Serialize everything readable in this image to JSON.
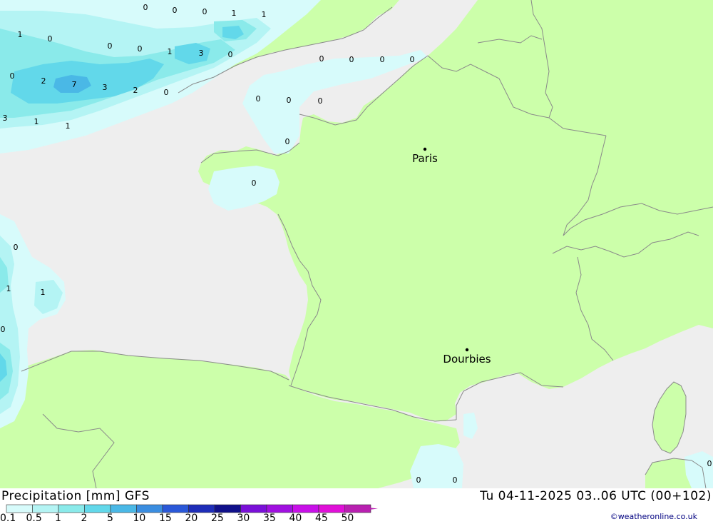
{
  "title": "Precipitation [mm] GFS",
  "datetime": "Tu 04-11-2025 03..06 UTC (00+102)",
  "credit": "©weatheronline.co.uk",
  "colors": {
    "land": "#ccffaa",
    "sea": "#eeeeee",
    "border": "#8a8a8a",
    "city_label": "#000000",
    "value_label": "#000000"
  },
  "legend": {
    "labels": [
      "0.1",
      "0.5",
      "1",
      "2",
      "5",
      "10",
      "15",
      "20",
      "25",
      "30",
      "35",
      "40",
      "45",
      "50"
    ],
    "colors": [
      "#d7fbfb",
      "#b4f4f4",
      "#8aeaea",
      "#62d8ea",
      "#4ab8e6",
      "#3a8de0",
      "#2a58d8",
      "#1e2db8",
      "#10108a",
      "#7a10d8",
      "#a010e0",
      "#c810e8",
      "#e010d8",
      "#b820b0"
    ]
  },
  "cities": [
    {
      "name": "Paris"
    },
    {
      "name": "Dourbies"
    }
  ],
  "values": [
    "0",
    "0",
    "0",
    "1",
    "1",
    "1",
    "0",
    "0",
    "0",
    "1",
    "3",
    "0",
    "0",
    "2",
    "7",
    "3",
    "2",
    "0",
    "3",
    "1",
    "1",
    "0",
    "0",
    "0",
    "0",
    "0",
    "0",
    "0",
    "0",
    "0",
    "0",
    "0",
    "1",
    "1",
    "0",
    "0",
    "0",
    "0"
  ]
}
